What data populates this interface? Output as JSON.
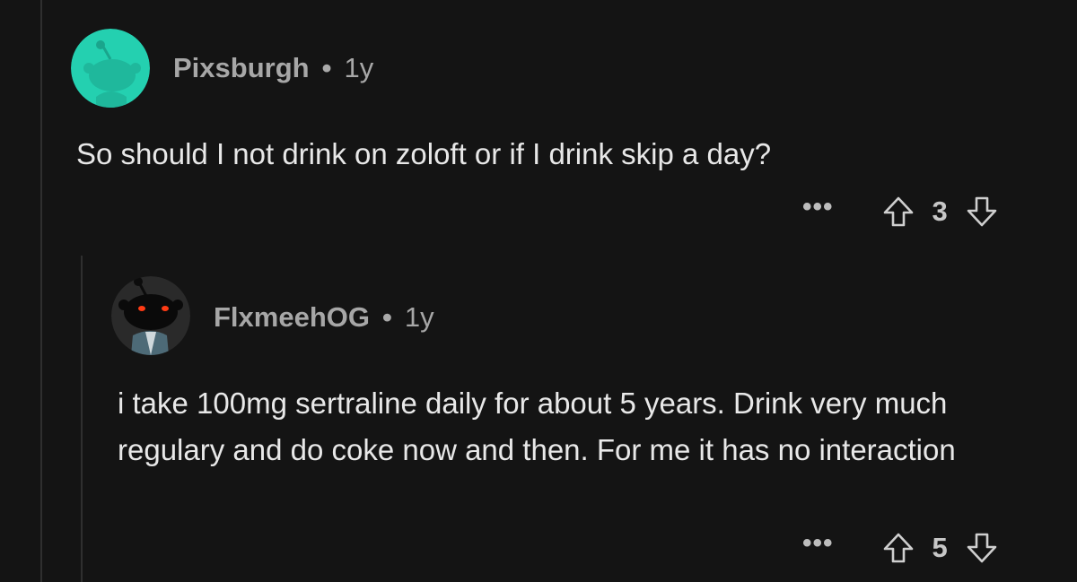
{
  "comments": [
    {
      "username": "Pixsburgh",
      "separator": "•",
      "age": "1y",
      "text": "So should I not drink on zoloft or if I drink skip a day?",
      "more": "•••",
      "score": "3",
      "avatar_color": "#24d0b0"
    },
    {
      "username": "FlxmeehOG",
      "separator": "•",
      "age": "1y",
      "text": "i take 100mg sertraline daily for about 5 years. Drink very much regulary and do coke now and then. For me it has no interaction",
      "more": "•••",
      "score": "5",
      "avatar_color": "#2a2a2a"
    }
  ],
  "icons": {
    "upvote": "upvote-arrow-icon",
    "downvote": "downvote-arrow-icon",
    "more": "more-dots-icon"
  }
}
